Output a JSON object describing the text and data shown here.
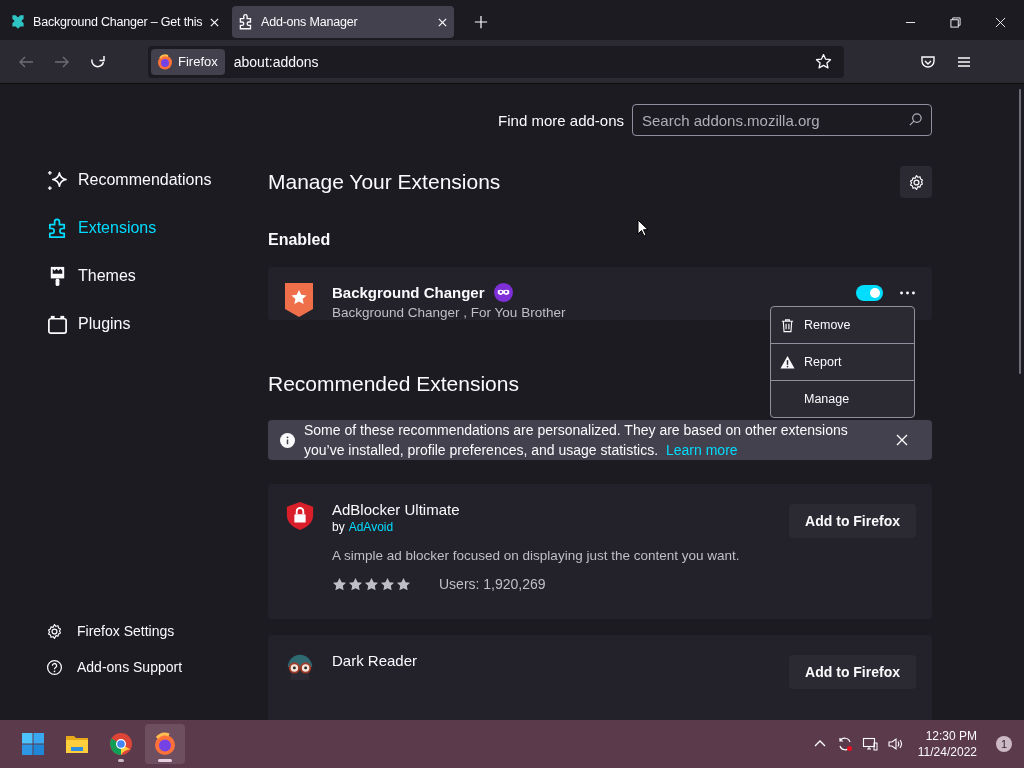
{
  "browser_tabs": [
    {
      "title": "Background Changer – Get this",
      "kind": "favicon",
      "selected": false
    },
    {
      "title": "Add-ons Manager",
      "kind": "addons",
      "selected": true
    }
  ],
  "toolbar": {
    "identity_label": "Firefox",
    "url": "about:addons",
    "back_disabled": true,
    "forward_disabled": true
  },
  "sidebar": {
    "categories": [
      {
        "label": "Recommendations",
        "kind": "recommendations",
        "selected": false
      },
      {
        "label": "Extensions",
        "kind": "extensions",
        "selected": true
      },
      {
        "label": "Themes",
        "kind": "themes",
        "selected": false
      },
      {
        "label": "Plugins",
        "kind": "plugins",
        "selected": false
      }
    ],
    "footer_links": [
      {
        "label": "Firefox Settings",
        "kind": "settings"
      },
      {
        "label": "Add-ons Support",
        "kind": "support"
      }
    ]
  },
  "header": {
    "find_more_label": "Find more add-ons",
    "search_placeholder": "Search addons.mozilla.org"
  },
  "page_title": "Manage Your Extensions",
  "enabled_section": {
    "heading": "Enabled",
    "extensions": [
      {
        "name": "Background Changer",
        "description": "Background Changer , For You Brother",
        "enabled": true
      }
    ]
  },
  "context_menu": {
    "items": [
      {
        "label": "Remove",
        "kind": "remove"
      },
      {
        "label": "Report",
        "kind": "report"
      },
      {
        "label": "Manage",
        "kind": "plain"
      }
    ]
  },
  "recommended": {
    "heading": "Recommended Extensions",
    "notice": {
      "text": "Some of these recommendations are personalized. They are based on other extensions you’ve installed, profile preferences, and usage statistics.",
      "link": "Learn more"
    },
    "addons": [
      {
        "name": "AdBlocker Ultimate",
        "kind": "shield",
        "by": "by",
        "author": "AdAvoid",
        "description": "A simple ad blocker focused on displaying just the content you want.",
        "stars": 5,
        "users": "Users: 1,920,269",
        "button": "Add to Firefox"
      },
      {
        "name": "Dark Reader",
        "kind": "glasses",
        "button": "Add to Firefox"
      }
    ]
  },
  "taskbar": {
    "apps": [
      {
        "kind": "start",
        "running": false,
        "selected": false
      },
      {
        "kind": "files",
        "running": false,
        "selected": false
      },
      {
        "kind": "chrome",
        "running": true,
        "selected": false
      },
      {
        "kind": "firefox",
        "running": true,
        "selected": true
      }
    ],
    "time": "12:30 PM",
    "date": "11/24/2022",
    "notification_count": "1"
  }
}
